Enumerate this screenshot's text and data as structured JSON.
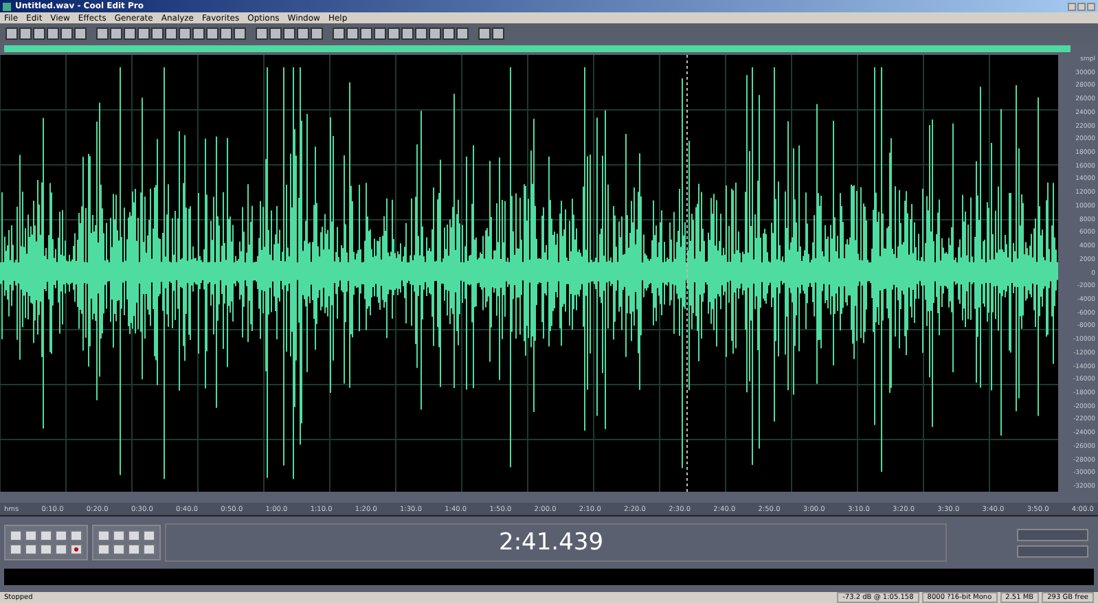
{
  "window": {
    "title": "Untitled.wav - Cool Edit Pro"
  },
  "menu": [
    "File",
    "Edit",
    "View",
    "Effects",
    "Generate",
    "Analyze",
    "Favorites",
    "Options",
    "Window",
    "Help"
  ],
  "amplitude_ruler": [
    "smpl",
    "30000",
    "28000",
    "26000",
    "24000",
    "22000",
    "20000",
    "18000",
    "16000",
    "14000",
    "12000",
    "10000",
    "8000",
    "6000",
    "4000",
    "2000",
    "0",
    "-2000",
    "-4000",
    "-6000",
    "-8000",
    "-10000",
    "-12000",
    "-14000",
    "-16000",
    "-18000",
    "-20000",
    "-22000",
    "-24000",
    "-26000",
    "-28000",
    "-30000",
    "-32000"
  ],
  "time_ruler": [
    "hms",
    "0:10.0",
    "0:20.0",
    "0:30.0",
    "0:40.0",
    "0:50.0",
    "1:00.0",
    "1:10.0",
    "1:20.0",
    "1:30.0",
    "1:40.0",
    "1:50.0",
    "2:00.0",
    "2:10.0",
    "2:20.0",
    "2:30.0",
    "2:40.0",
    "2:50.0",
    "3:00.0",
    "3:10.0",
    "3:20.0",
    "3:30.0",
    "3:40.0",
    "3:50.0",
    "4:00.0"
  ],
  "time_display": "2:41.439",
  "status_bar": {
    "state": "Stopped",
    "fields": [
      "-73.2 dB @ 1:05.158",
      "8000 ?16-bit Mono",
      "2.51 MB",
      "293 GB free"
    ]
  }
}
